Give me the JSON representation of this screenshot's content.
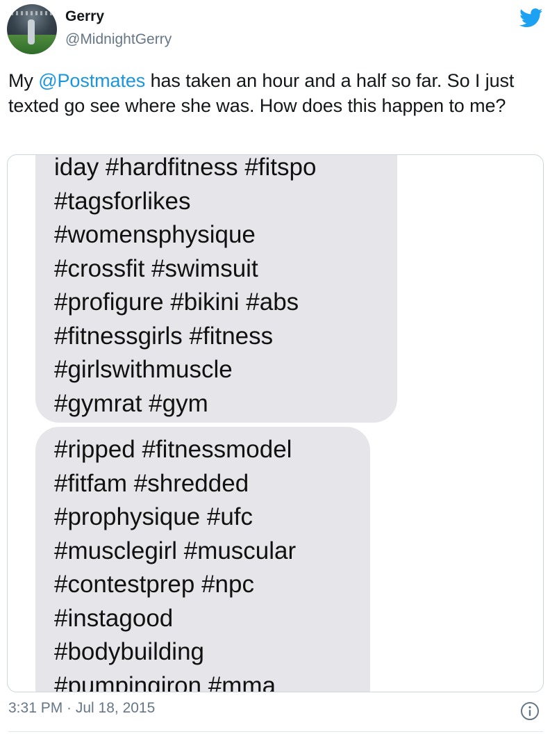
{
  "user": {
    "name": "Gerry",
    "handle": "@MidnightGerry"
  },
  "tweet": {
    "text_before": "My ",
    "mention": "@Postmates",
    "text_after": " has taken an hour and a half so far. So I just texted go see where she was. How does this happen to me?",
    "timestamp": "3:31 PM · Jul 18, 2015"
  },
  "media": {
    "bubble1_lines": [
      "iday #hardfitness #fitspo",
      "#tagsforlikes",
      "#womensphysique",
      "#crossfit #swimsuit",
      "#profigure #bikini #abs",
      "#fitnessgirls #fitness",
      "#girlswithmuscle",
      "#gymrat #gym"
    ],
    "bubble2_lines": [
      "#ripped #fitnessmodel",
      "#fitfam #shredded",
      "#prophysique #ufc",
      "#musclegirl #muscular",
      "#contestprep #npc",
      "#instagood",
      "#bodybuilding",
      "#pumpingiron #mma"
    ]
  },
  "icons": {
    "brand": "twitter-bird-icon",
    "info": "info-icon"
  },
  "colors": {
    "accent": "#1da1f2",
    "mention": "#1b95e0",
    "bubble": "#e5e5ea",
    "muted": "#657786"
  }
}
